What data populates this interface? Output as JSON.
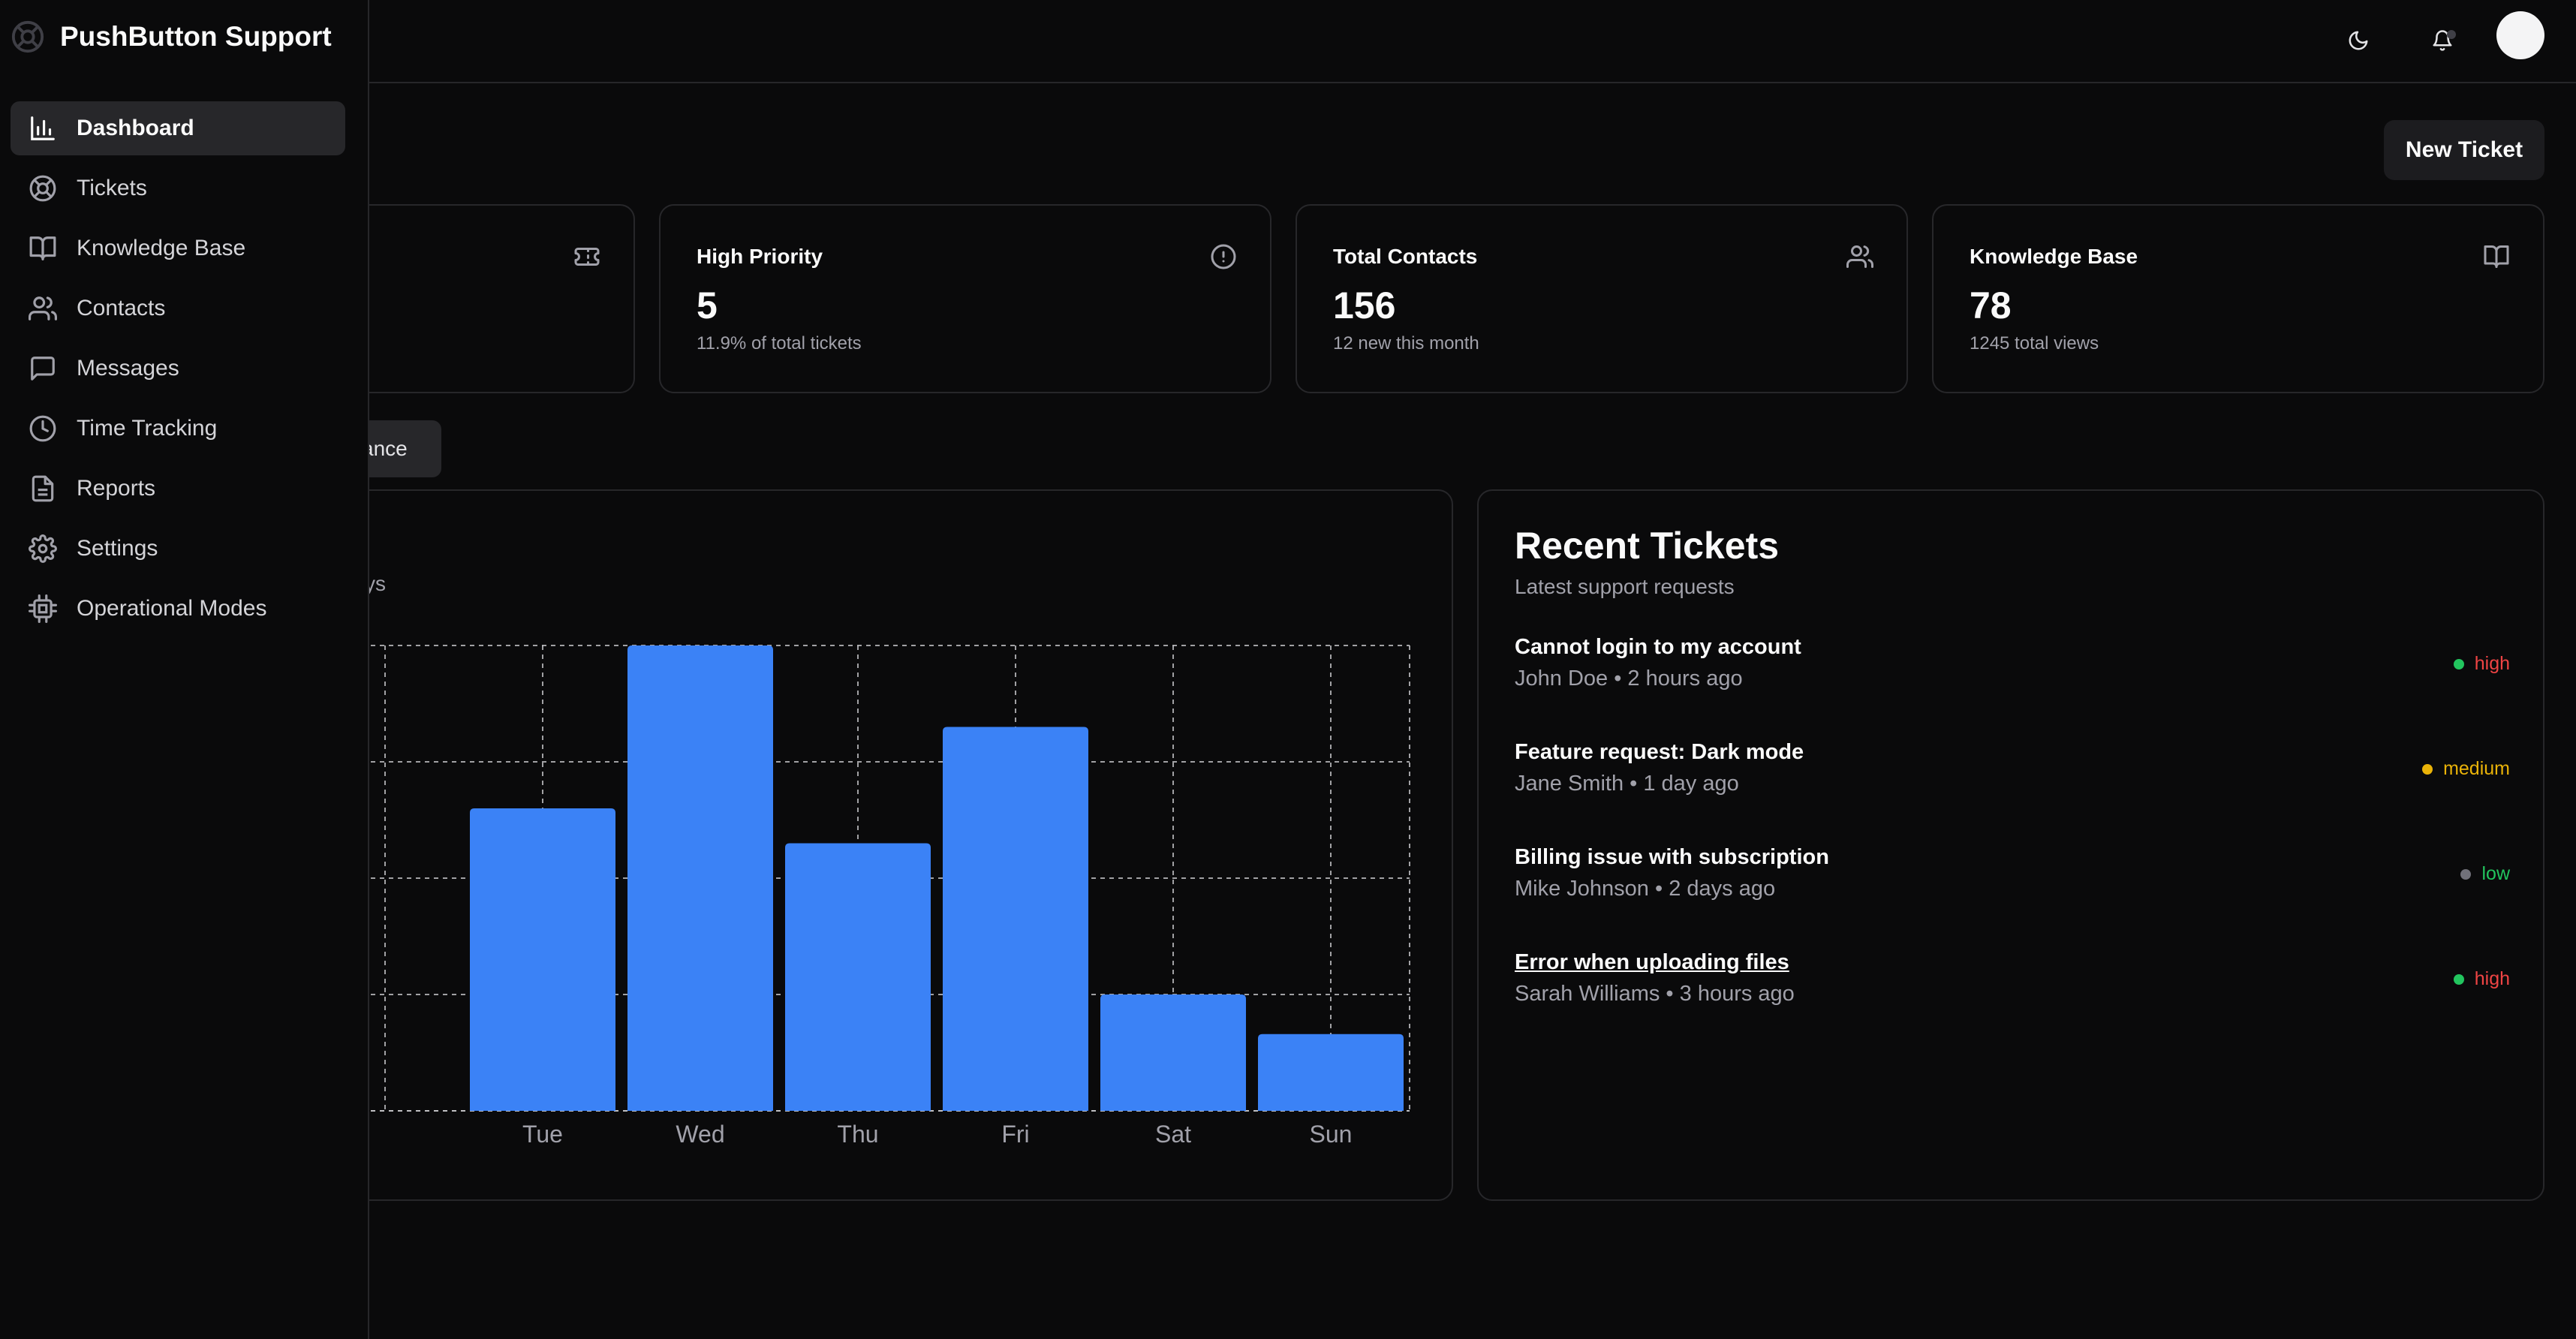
{
  "sidebar": {
    "brand": "PushButton Support",
    "items": [
      {
        "label": "Dashboard",
        "icon": "bar-chart-icon",
        "active": true
      },
      {
        "label": "Tickets",
        "icon": "lifebuoy-icon"
      },
      {
        "label": "Knowledge Base",
        "icon": "book-icon"
      },
      {
        "label": "Contacts",
        "icon": "users-icon"
      },
      {
        "label": "Messages",
        "icon": "message-icon"
      },
      {
        "label": "Time Tracking",
        "icon": "clock-icon"
      },
      {
        "label": "Reports",
        "icon": "file-text-icon"
      },
      {
        "label": "Settings",
        "icon": "gear-icon"
      },
      {
        "label": "Operational Modes",
        "icon": "cpu-icon"
      }
    ]
  },
  "header": {
    "theme_icon": "moon-icon",
    "notifications_icon": "bell-icon"
  },
  "main": {
    "new_ticket_label": "New Ticket",
    "tab_partial_label": "ance",
    "chart_subtitle_partial": "ys"
  },
  "stats": [
    {
      "title": "",
      "value": "",
      "sub": "",
      "icon": "ticket-icon"
    },
    {
      "title": "High Priority",
      "value": "5",
      "sub": "11.9% of total tickets",
      "icon": "alert-circle-icon"
    },
    {
      "title": "Total Contacts",
      "value": "156",
      "sub": "12 new this month",
      "icon": "users-icon"
    },
    {
      "title": "Knowledge Base",
      "value": "78",
      "sub": "1245 total views",
      "icon": "book-open-icon"
    }
  ],
  "chart_data": {
    "type": "bar",
    "categories": [
      "Tue",
      "Wed",
      "Thu",
      "Fri",
      "Sat",
      "Sun"
    ],
    "values": [
      26,
      40,
      23,
      33,
      10,
      6.6
    ],
    "ylim": [
      0,
      40
    ],
    "grid": true,
    "bar_color": "#3b82f6"
  },
  "recent": {
    "title": "Recent Tickets",
    "subtitle": "Latest support requests",
    "tickets": [
      {
        "title": "Cannot login to my account",
        "meta": "John Doe • 2 hours ago",
        "priority": "high",
        "dot": "#22c55e",
        "prio_color": "#ef4444"
      },
      {
        "title": "Feature request: Dark mode",
        "meta": "Jane Smith • 1 day ago",
        "priority": "medium",
        "dot": "#eab308",
        "prio_color": "#eab308"
      },
      {
        "title": "Billing issue with subscription",
        "meta": "Mike Johnson • 2 days ago",
        "priority": "low",
        "dot": "#71717a",
        "prio_color": "#22c55e"
      },
      {
        "title": "Error when uploading files",
        "meta": "Sarah Williams • 3 hours ago",
        "priority": "high",
        "dot": "#22c55e",
        "prio_color": "#ef4444"
      }
    ]
  }
}
